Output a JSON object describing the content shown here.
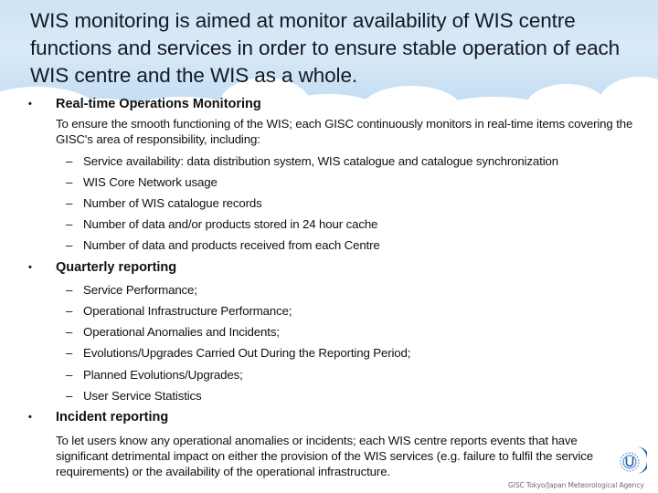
{
  "slide": {
    "title": "WIS monitoring is aimed at monitor availability of WIS centre functions and services in order to ensure stable operation of each WIS centre and the WIS as a whole.",
    "sections": [
      {
        "heading": "Real-time Operations Monitoring",
        "intro": "To ensure the smooth functioning of the WIS; each GISC continuously monitors in real-time items covering the GISC's area of responsibility, including:",
        "items": [
          "Service availability: data distribution system, WIS catalogue and catalogue synchronization",
          "WIS Core Network usage",
          "Number of WIS catalogue records",
          "Number of data and/or products stored in 24 hour cache",
          "Number of data and products received from each Centre"
        ]
      },
      {
        "heading": "Quarterly reporting",
        "items": [
          "Service Performance;",
          "Operational Infrastructure Performance;",
          "Operational Anomalies and Incidents;",
          "Evolutions/Upgrades Carried Out During the Reporting Period;",
          "Planned Evolutions/Upgrades;",
          "User Service Statistics"
        ]
      },
      {
        "heading": "Incident reporting",
        "intro": "To let users know any operational anomalies or incidents; each WIS centre reports events that have significant detrimental impact on either the provision of the WIS services (e.g. failure to fulfil the service requirements) or the availability of the operational infrastructure."
      }
    ],
    "bullet_glyph": "•",
    "dash_glyph": "–",
    "logo_icon": "wmo-logo-icon",
    "credit": "GISC Tokyo/Japan Meteorological Agency",
    "colors": {
      "sky": "#cfe3f6",
      "logo": "#1b5aa8",
      "text": "#111111"
    }
  }
}
